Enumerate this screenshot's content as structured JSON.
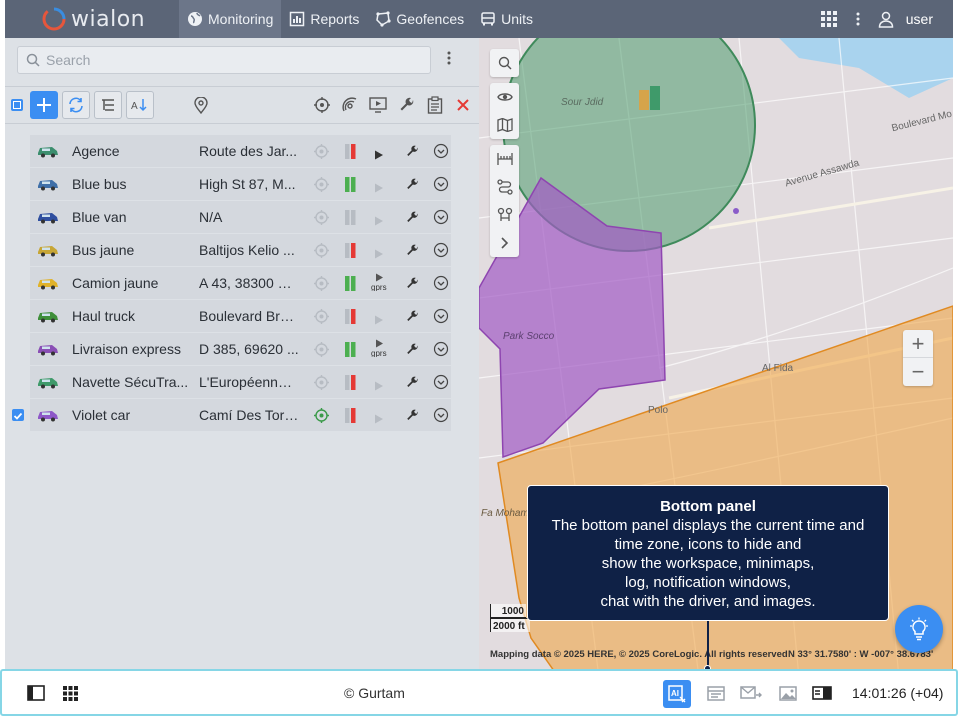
{
  "app": {
    "logo_text": "wialon"
  },
  "nav": {
    "monitoring": "Monitoring",
    "reports": "Reports",
    "geofences": "Geofences",
    "units": "Units",
    "user": "user"
  },
  "search": {
    "placeholder": "Search"
  },
  "units": [
    {
      "name": "Agence",
      "address": "Route des Jar...",
      "color": "#3c8e6e",
      "status": "red",
      "command": "play",
      "selected": false
    },
    {
      "name": "Blue bus",
      "address": "High St 87, M...",
      "color": "#3f6fa8",
      "status": "green",
      "command": "play-dim",
      "selected": false
    },
    {
      "name": "Blue van",
      "address": "N/A",
      "color": "#2f4fa0",
      "status": "gray",
      "command": "play-dim",
      "selected": false
    },
    {
      "name": "Bus jaune",
      "address": "Baltijos Kelio ...",
      "color": "#c7a636",
      "status": "red",
      "command": "play-dim",
      "selected": false
    },
    {
      "name": "Camion jaune",
      "address": "A 43, 38300 R...",
      "color": "#e0b22a",
      "status": "green",
      "command": "gprs",
      "selected": false
    },
    {
      "name": "Haul truck",
      "address": "Boulevard Bra...",
      "color": "#3f8f3a",
      "status": "red",
      "command": "play-dim",
      "selected": false
    },
    {
      "name": "Livraison express",
      "address": "D 385, 69620 ...",
      "color": "#8a4fb5",
      "status": "green",
      "command": "gprs",
      "selected": false
    },
    {
      "name": "Navette SécuTra...",
      "address": "L'Européenne, ...",
      "color": "#3f9a6a",
      "status": "red",
      "command": "play-dim",
      "selected": false
    },
    {
      "name": "Violet car",
      "address": "Camí Des Torr...",
      "color": "#8e58c8",
      "status": "red",
      "command": "play-dim",
      "selected": true
    }
  ],
  "map": {
    "scale_top": "1000",
    "scale_bottom": "2000 ft",
    "attribution": "Mapping data © 2025 HERE, © 2025 CoreLogic. All rights reserved",
    "coords": "N 33° 31.7580' : W -007° 38.6783'",
    "labels": [
      "Sour Jdid",
      "Boulevard Mo",
      "Avenue Assawda",
      "Al Fida",
      "Park Socco",
      "Fa Mohammedi",
      "Polo"
    ]
  },
  "tooltip": {
    "title": "Bottom panel",
    "lines": [
      "The bottom panel displays the current time and",
      "time zone, icons to hide and",
      "show the workspace, minimaps,",
      "log, notification windows,",
      "chat with the driver, and images."
    ]
  },
  "bottom": {
    "copyright": "© Gurtam",
    "time": "14:01:26 (+04)"
  },
  "colors": {
    "accent": "#3b8ef2",
    "topbar": "#5b6577",
    "tooltip_bg": "#0f2146",
    "geofence_green": "#4f9d6d",
    "geofence_purple": "#a35bc4",
    "geofence_orange": "#f0a64a"
  }
}
